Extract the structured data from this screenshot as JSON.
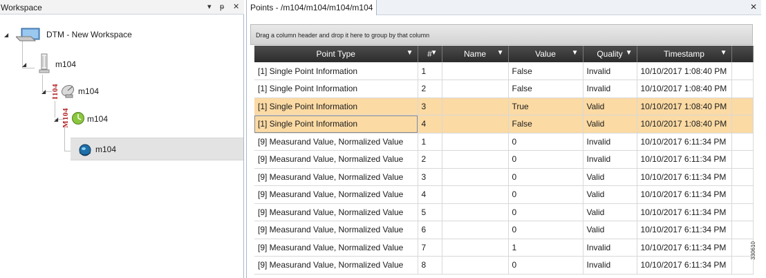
{
  "workspace": {
    "title": "Workspace",
    "controls": {
      "dropdown": "▾",
      "pin": "ᵽ",
      "close": "✕"
    },
    "tree": {
      "root": {
        "label": "DTM - New Workspace",
        "icon": "workstation-icon"
      },
      "level1": {
        "label": "m104",
        "icon": "device-rack-icon"
      },
      "level2": {
        "label": "m104",
        "icon": "satellite-dish-icon",
        "tag": "I104"
      },
      "level3": {
        "label": "m104",
        "icon": "green-clock-icon",
        "tag": "M104"
      },
      "level4": {
        "label": "m104",
        "icon": "globe-icon"
      }
    }
  },
  "points": {
    "tab_label": "Points - /m104/m104/m104/m104",
    "close": "✕",
    "group_hint": "Drag a column header and drop it here to group by that column",
    "columns": [
      "Point Type",
      "#",
      "Name",
      "Value",
      "Quality",
      "Timestamp"
    ],
    "rows": [
      [
        "[1] Single Point Information",
        "1",
        "",
        "False",
        "Invalid",
        "10/10/2017 1:08:40 PM"
      ],
      [
        "[1] Single Point Information",
        "2",
        "",
        "False",
        "Invalid",
        "10/10/2017 1:08:40 PM"
      ],
      [
        "[1] Single Point Information",
        "3",
        "",
        "True",
        "Valid",
        "10/10/2017 1:08:40 PM"
      ],
      [
        "[1] Single Point Information",
        "4",
        "",
        "False",
        "Valid",
        "10/10/2017 1:08:40 PM"
      ],
      [
        "[9] Measurand Value, Normalized Value",
        "1",
        "",
        "0",
        "Invalid",
        "10/10/2017 6:11:34 PM"
      ],
      [
        "[9] Measurand Value, Normalized Value",
        "2",
        "",
        "0",
        "Invalid",
        "10/10/2017 6:11:34 PM"
      ],
      [
        "[9] Measurand Value, Normalized Value",
        "3",
        "",
        "0",
        "Valid",
        "10/10/2017 6:11:34 PM"
      ],
      [
        "[9] Measurand Value, Normalized Value",
        "4",
        "",
        "0",
        "Valid",
        "10/10/2017 6:11:34 PM"
      ],
      [
        "[9] Measurand Value, Normalized Value",
        "5",
        "",
        "0",
        "Valid",
        "10/10/2017 6:11:34 PM"
      ],
      [
        "[9] Measurand Value, Normalized Value",
        "6",
        "",
        "0",
        "Valid",
        "10/10/2017 6:11:34 PM"
      ],
      [
        "[9] Measurand Value, Normalized Value",
        "7",
        "",
        "1",
        "Invalid",
        "10/10/2017 6:11:34 PM"
      ],
      [
        "[9] Measurand Value, Normalized Value",
        "8",
        "",
        "0",
        "Invalid",
        "10/10/2017 6:11:34 PM"
      ]
    ],
    "selected_rows": [
      2,
      3
    ],
    "current_cell_row": 3
  },
  "colors": {
    "selection": "#fbdaa4",
    "header_dark": "#3a3a3a",
    "tag_red": "#b22222"
  },
  "side_code": "330610"
}
